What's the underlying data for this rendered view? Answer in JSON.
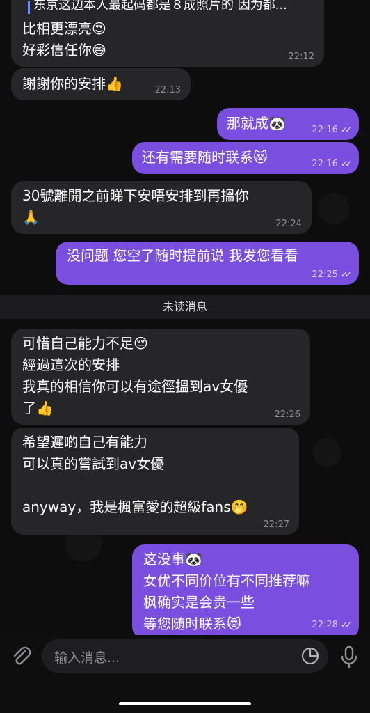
{
  "messages": [
    {
      "id": "m1",
      "dir": "in",
      "reply_preview": "东京这边本人最起码都是８成照片的 因为都...",
      "text": "比相更漂亮😍\n好彩信任你😅",
      "time": "22:12"
    },
    {
      "id": "m2",
      "dir": "in",
      "text": "謝謝你的安排👍",
      "time": "22:13"
    },
    {
      "id": "m3",
      "dir": "out",
      "text": "那就成🐼",
      "time": "22:16"
    },
    {
      "id": "m4",
      "dir": "out",
      "text": "还有需要随时联系😻",
      "time": "22:16"
    },
    {
      "id": "m5",
      "dir": "in",
      "text": "30號離開之前睇下安唔安排到再搵你\n🙏",
      "time": "22:24"
    },
    {
      "id": "m6",
      "dir": "out",
      "text": "没问题 您空了随时提前说 我发您看看",
      "time": "22:25"
    },
    {
      "id": "m7",
      "dir": "in",
      "text": "可惜自己能力不足😔\n經過這次的安排\n我真的相信你可以有途徑搵到av女優\n了👍",
      "time": "22:26"
    },
    {
      "id": "m8",
      "dir": "in",
      "text": "希望遲啲自己有能力\n可以真的嘗試到av女優\n\nanyway，我是楓富愛的超級fans🤭",
      "time": "22:27"
    },
    {
      "id": "m9",
      "dir": "out",
      "text": "这没事🐼\n女优不同价位有不同推荐嘛\n枫确实是会贵一些\n等您随时联系😻",
      "time": "22:28"
    }
  ],
  "divider": {
    "label": "未读消息"
  },
  "composer": {
    "placeholder": "输入消息..."
  },
  "icons": {
    "attach": "paperclip-icon",
    "sticker": "sticker-icon",
    "mic": "microphone-icon"
  },
  "colors": {
    "incoming": "#262628",
    "outgoing": "#7a4fe0",
    "background": "#0d0d0d"
  }
}
